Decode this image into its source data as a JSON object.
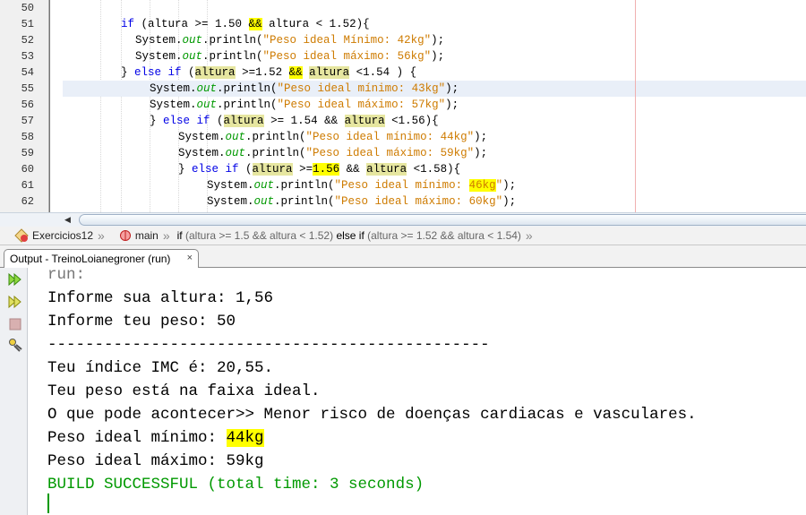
{
  "editor": {
    "line_numbers": [
      "50",
      "51",
      "52",
      "53",
      "54",
      "55",
      "56",
      "57",
      "58",
      "59",
      "60",
      "61",
      "62"
    ],
    "lines": [
      [],
      [
        [
          "if",
          "k"
        ],
        [
          " (altura >= 1.50 ",
          ""
        ],
        [
          "&&",
          "h"
        ],
        [
          " altura < 1.52){",
          ""
        ]
      ],
      [
        [
          "System.",
          ""
        ],
        [
          "out",
          "o"
        ],
        [
          ".println(",
          ""
        ],
        [
          "\"Peso ideal Mínimo: 42kg\"",
          "s"
        ],
        [
          ");",
          ""
        ]
      ],
      [
        [
          "System.",
          ""
        ],
        [
          "out",
          "o"
        ],
        [
          ".println(",
          ""
        ],
        [
          "\"Peso ideal máximo: 56kg\"",
          "s"
        ],
        [
          ");",
          ""
        ]
      ],
      [
        [
          "} ",
          ""
        ],
        [
          "else if",
          "k"
        ],
        [
          " (",
          ""
        ],
        [
          "altura",
          "m"
        ],
        [
          " >=1.52 ",
          ""
        ],
        [
          "&&",
          "h"
        ],
        [
          " ",
          ""
        ],
        [
          "altura",
          "m"
        ],
        [
          " <1.54 ) {",
          ""
        ]
      ],
      [
        [
          "System.",
          ""
        ],
        [
          "out",
          "o"
        ],
        [
          ".println(",
          ""
        ],
        [
          "\"Peso ideal mínimo: 43kg\"",
          "s"
        ],
        [
          ");",
          ""
        ]
      ],
      [
        [
          "System.",
          ""
        ],
        [
          "out",
          "o"
        ],
        [
          ".println(",
          ""
        ],
        [
          "\"Peso ideal máximo: 57kg\"",
          "s"
        ],
        [
          ");",
          ""
        ]
      ],
      [
        [
          "} ",
          ""
        ],
        [
          "else if",
          "k"
        ],
        [
          " (",
          ""
        ],
        [
          "altura",
          "m"
        ],
        [
          " >= 1.54 && ",
          ""
        ],
        [
          "altura",
          "m"
        ],
        [
          " <1.56){",
          ""
        ]
      ],
      [
        [
          "System.",
          ""
        ],
        [
          "out",
          "o"
        ],
        [
          ".println(",
          ""
        ],
        [
          "\"Peso ideal mínimo: 44kg\"",
          "s"
        ],
        [
          ");",
          ""
        ]
      ],
      [
        [
          "System.",
          ""
        ],
        [
          "out",
          "o"
        ],
        [
          ".println(",
          ""
        ],
        [
          "\"Peso ideal máximo: 59kg\"",
          "s"
        ],
        [
          ");",
          ""
        ]
      ],
      [
        [
          "} ",
          ""
        ],
        [
          "else if",
          "k"
        ],
        [
          " (",
          ""
        ],
        [
          "altura",
          "m"
        ],
        [
          " >=",
          ""
        ],
        [
          "1.56",
          "h"
        ],
        [
          " && ",
          ""
        ],
        [
          "altura",
          "m"
        ],
        [
          " <1.58){",
          ""
        ]
      ],
      [
        [
          "System.",
          ""
        ],
        [
          "out",
          "o"
        ],
        [
          ".println(",
          ""
        ],
        [
          "\"Peso ideal mínimo: ",
          "s"
        ],
        [
          "46kg",
          "s h"
        ],
        [
          "\"",
          "s"
        ],
        [
          ");",
          ""
        ]
      ],
      [
        [
          "System.",
          ""
        ],
        [
          "out",
          "o"
        ],
        [
          ".println(",
          ""
        ],
        [
          "\"Peso ideal máximo: 60kg\"",
          "s"
        ],
        [
          ");",
          ""
        ]
      ]
    ]
  },
  "breadcrumb": {
    "class_name": "Exercicios12",
    "method_name": "main",
    "kw_if": "if",
    "cond1": "(altura >= 1.5 && altura < 1.52)",
    "kw_else_if": "else if",
    "cond2": "(altura >= 1.52 && altura < 1.54)"
  },
  "output": {
    "tab_label": "Output - TreinoLoianegroner (run)",
    "close_glyph": "×",
    "lines": [
      "run:",
      "Informe sua altura: 1,56",
      "Informe teu peso: 50",
      "-----------------------------------------------",
      "Teu índice IMC é: 20,55.",
      "Teu peso está na faixa ideal.",
      "O que pode acontecer>> Menor risco de doenças cardiacas e vasculares.",
      "Peso ideal mínimo: ",
      "Peso ideal máximo: 59kg",
      "BUILD SUCCESSFUL (total time: 3 seconds)"
    ],
    "highlighted_value": "44kg"
  },
  "icons": [
    "rerun-icon",
    "rerun-with-options-icon",
    "stop-icon",
    "settings-icon"
  ]
}
